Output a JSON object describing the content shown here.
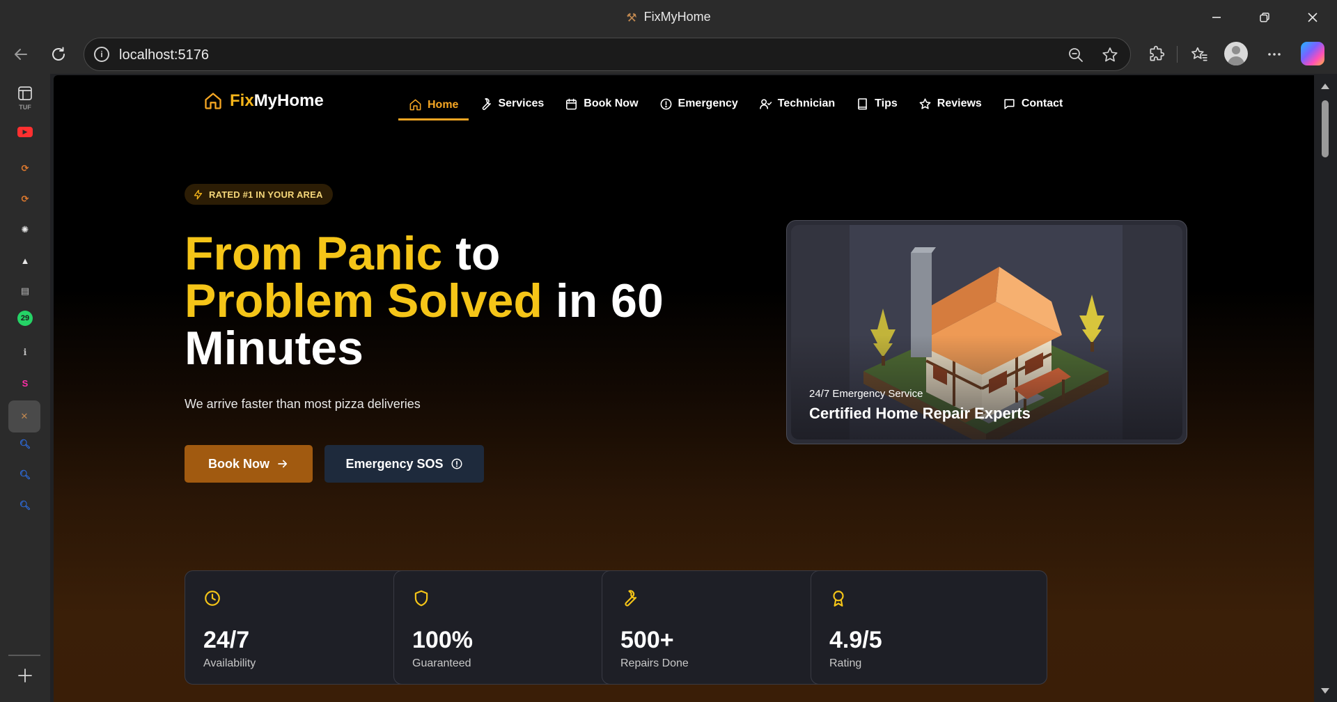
{
  "browser": {
    "window_title": "FixMyHome",
    "url": "localhost:5176"
  },
  "sidebar_tabs": [
    {
      "icon": "tuf-icon",
      "glyph": "TUF",
      "color": "#9a9a9a"
    },
    {
      "icon": "youtube-icon",
      "glyph": "▶",
      "color": "#ff3030"
    },
    {
      "icon": "gradient-app-icon",
      "glyph": "⟳",
      "color": "#e07a2e"
    },
    {
      "icon": "gradient-app-icon-2",
      "glyph": "⟳",
      "color": "#e07a2e"
    },
    {
      "icon": "openai-icon",
      "glyph": "✺",
      "color": "#e8e8e8"
    },
    {
      "icon": "triangle-app-icon",
      "glyph": "▲",
      "color": "#e8e8e8"
    },
    {
      "icon": "window-app-icon",
      "glyph": "▤",
      "color": "#bdbdbd"
    },
    {
      "icon": "whatsapp-icon",
      "glyph": "29",
      "color": "#25d366"
    },
    {
      "icon": "info-app-icon",
      "glyph": "ℹ",
      "color": "#bdbdbd"
    },
    {
      "icon": "s-app-icon",
      "glyph": "S",
      "color": "#ff2fa8"
    },
    {
      "icon": "fixmyhome-tab-icon",
      "glyph": "✕",
      "color": "#c08850"
    },
    {
      "icon": "search-tab-icon",
      "glyph": "🔍︎",
      "color": "#2d6cdf"
    },
    {
      "icon": "search-tab-icon-2",
      "glyph": "🔍︎",
      "color": "#2d6cdf"
    },
    {
      "icon": "search-tab-icon-3",
      "glyph": "🔍︎",
      "color": "#2d6cdf"
    }
  ],
  "site": {
    "logo_fix": "Fix",
    "logo_home": "MyHome",
    "nav": [
      {
        "label": "Home",
        "icon": "home-icon",
        "active": true
      },
      {
        "label": "Services",
        "icon": "wrench-icon",
        "active": false
      },
      {
        "label": "Book Now",
        "icon": "calendar-icon",
        "active": false
      },
      {
        "label": "Emergency",
        "icon": "alert-circle-icon",
        "active": false
      },
      {
        "label": "Technician",
        "icon": "user-check-icon",
        "active": false
      },
      {
        "label": "Tips",
        "icon": "book-icon",
        "active": false
      },
      {
        "label": "Reviews",
        "icon": "star-icon",
        "active": false
      },
      {
        "label": "Contact",
        "icon": "message-icon",
        "active": false
      }
    ]
  },
  "hero": {
    "badge": "RATED #1 IN YOUR AREA",
    "title_accent_1": "From Panic",
    "title_plain_1": " to",
    "title_accent_2": "Problem Solved",
    "title_plain_2": " in 60 Minutes",
    "subtitle": "We arrive faster than most pizza deliveries",
    "book_button": "Book Now",
    "sos_button": "Emergency SOS",
    "card_kicker": "24/7 Emergency Service",
    "card_title": "Certified Home Repair Experts"
  },
  "stats": [
    {
      "icon": "clock-icon",
      "value": "24/7",
      "label": "Availability"
    },
    {
      "icon": "shield-icon",
      "value": "100%",
      "label": "Guaranteed"
    },
    {
      "icon": "wrench-icon",
      "value": "500+",
      "label": "Repairs Done"
    },
    {
      "icon": "award-icon",
      "value": "4.9/5",
      "label": "Rating"
    }
  ],
  "colors": {
    "accent_yellow": "#f5c518",
    "accent_orange": "#f5a623",
    "book_button_bg": "#a15a10",
    "sos_button_bg": "#1e2a3c"
  }
}
